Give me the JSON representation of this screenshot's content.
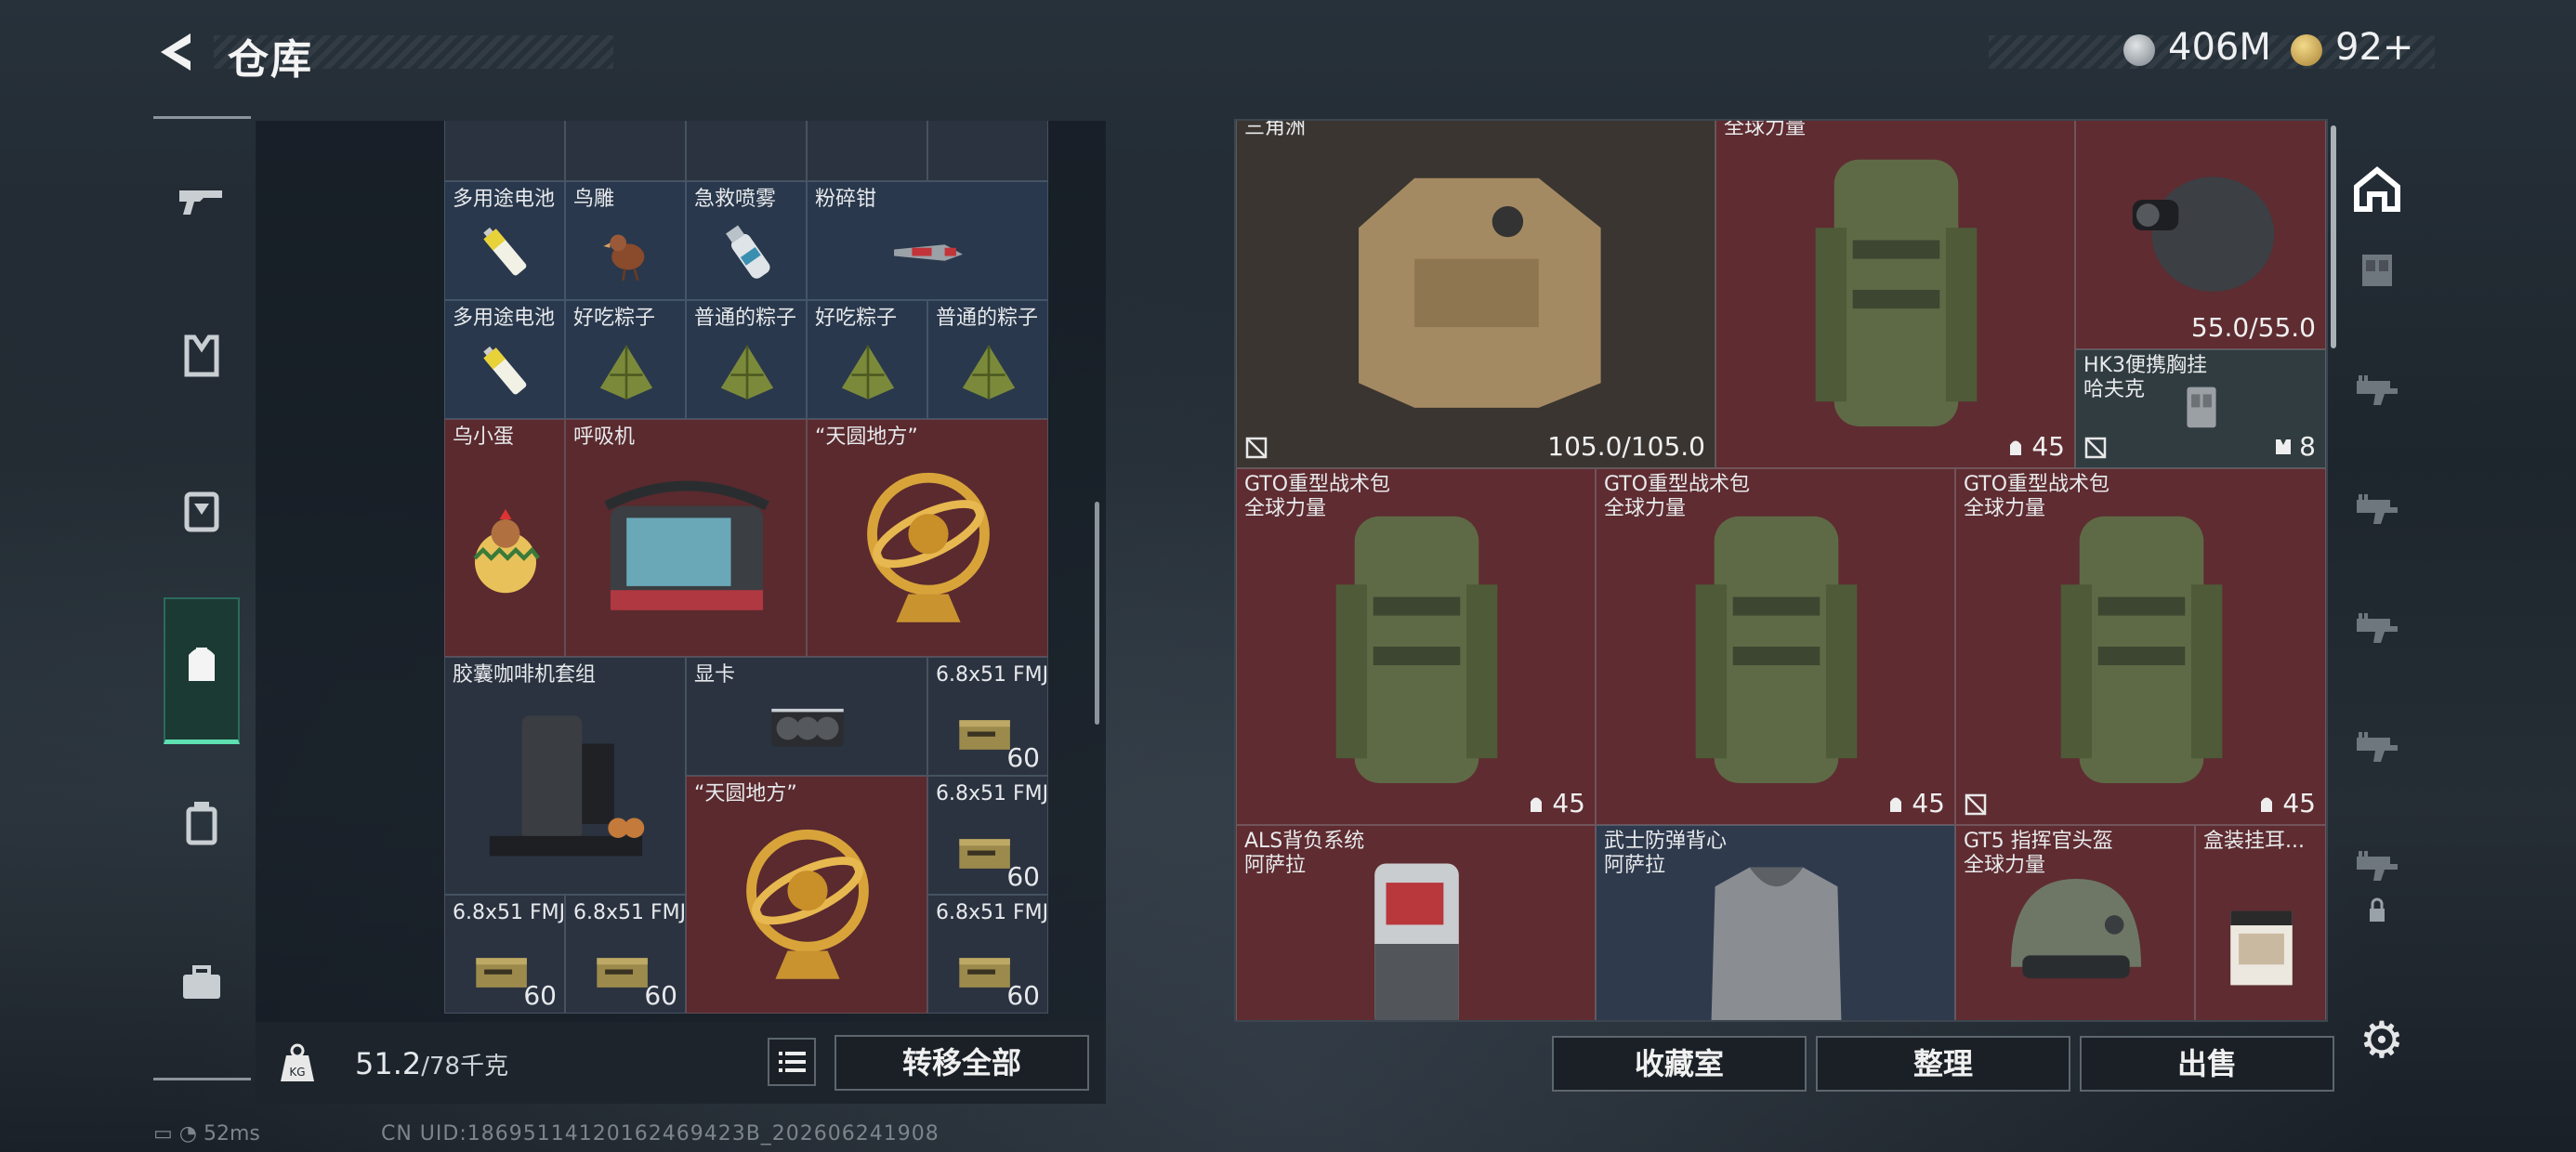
{
  "header": {
    "title": "仓库",
    "silver": "406M",
    "gold": "92+"
  },
  "sidebar": {
    "items": [
      "gun-icon",
      "armor-vest-icon",
      "chest-rig-icon",
      "backpack-icon",
      "case-icon",
      "toolbox-icon"
    ],
    "active": 3
  },
  "left_grid": [
    {
      "name": "多用途电池",
      "count": "",
      "col": 0,
      "row": 0,
      "w": 1,
      "h": 1,
      "color": "blue",
      "icon": "battery"
    },
    {
      "name": "鸟雕",
      "count": "",
      "col": 1,
      "row": 0,
      "w": 1,
      "h": 1,
      "color": "blue",
      "icon": "bird"
    },
    {
      "name": "急救喷雾",
      "count": "",
      "col": 2,
      "row": 0,
      "w": 1,
      "h": 1,
      "color": "blue",
      "icon": "spray"
    },
    {
      "name": "粉碎钳",
      "count": "",
      "col": 3,
      "row": 0,
      "w": 2,
      "h": 1,
      "color": "blue",
      "icon": "cutter"
    },
    {
      "name": "多用途电池",
      "count": "",
      "col": 0,
      "row": 1,
      "w": 1,
      "h": 1,
      "color": "blue",
      "icon": "battery"
    },
    {
      "name": "好吃粽子",
      "count": "",
      "col": 1,
      "row": 1,
      "w": 1,
      "h": 1,
      "color": "blue",
      "icon": "zongzi"
    },
    {
      "name": "普通的粽子",
      "count": "",
      "col": 2,
      "row": 1,
      "w": 1,
      "h": 1,
      "color": "blue",
      "icon": "zongzi"
    },
    {
      "name": "好吃粽子",
      "count": "",
      "col": 3,
      "row": 1,
      "w": 1,
      "h": 1,
      "color": "blue",
      "icon": "zongzi"
    },
    {
      "name": "普通的粽子",
      "count": "",
      "col": 4,
      "row": 1,
      "w": 1,
      "h": 1,
      "color": "blue",
      "icon": "zongzi"
    },
    {
      "name": "乌小蛋",
      "count": "",
      "col": 0,
      "row": 2,
      "w": 1,
      "h": 2,
      "color": "red",
      "icon": "egg"
    },
    {
      "name": "呼吸机",
      "count": "",
      "col": 1,
      "row": 2,
      "w": 2,
      "h": 2,
      "color": "red",
      "icon": "machine"
    },
    {
      "name": "“天圆地方”",
      "count": "",
      "col": 3,
      "row": 2,
      "w": 2,
      "h": 2,
      "color": "red",
      "icon": "globe"
    },
    {
      "name": "胶囊咖啡机套组",
      "count": "",
      "col": 0,
      "row": 4,
      "w": 2,
      "h": 2,
      "color": "dark",
      "icon": "coffee"
    },
    {
      "name": "显卡",
      "count": "",
      "col": 2,
      "row": 4,
      "w": 2,
      "h": 1,
      "color": "dark",
      "icon": "gpu"
    },
    {
      "name": "6.8x51 FMJ",
      "count": "60",
      "col": 4,
      "row": 4,
      "w": 1,
      "h": 1,
      "color": "dark",
      "icon": "ammo"
    },
    {
      "name": "“天圆地方”",
      "count": "",
      "col": 2,
      "row": 5,
      "w": 2,
      "h": 2,
      "color": "red",
      "icon": "globe"
    },
    {
      "name": "6.8x51 FMJ",
      "count": "60",
      "col": 4,
      "row": 5,
      "w": 1,
      "h": 1,
      "color": "dark",
      "icon": "ammo"
    },
    {
      "name": "6.8x51 FMJ",
      "count": "60",
      "col": 0,
      "row": 6,
      "w": 1,
      "h": 1,
      "color": "dark",
      "icon": "ammo"
    },
    {
      "name": "6.8x51 FMJ",
      "count": "60",
      "col": 1,
      "row": 6,
      "w": 1,
      "h": 1,
      "color": "dark",
      "icon": "ammo"
    },
    {
      "name": "6.8x51 FMJ",
      "count": "60",
      "col": 4,
      "row": 6,
      "w": 1,
      "h": 1,
      "color": "dark",
      "icon": "ammo"
    }
  ],
  "left_bar": {
    "weight_current": "51.2",
    "weight_max": "/78千克",
    "transfer_label": "转移全部"
  },
  "right_grid": [
    {
      "name": "三角洲",
      "sub": "",
      "value": "105.0/105.0",
      "badge": "",
      "col": 0,
      "row": 0,
      "w": 4,
      "h": 3,
      "color": "dark",
      "icon": "vest",
      "noins": true
    },
    {
      "name": "全球力量",
      "sub": "",
      "value": "45",
      "badge": "helmet",
      "col": 4,
      "row": 0,
      "w": 3,
      "h": 3,
      "color": "red",
      "icon": "pack",
      "noins": false
    },
    {
      "name": "",
      "sub": "",
      "value": "55.0/55.0",
      "badge": "",
      "col": 7,
      "row": 0,
      "w": 2,
      "h": 2,
      "color": "red",
      "icon": "nvg",
      "noins": false
    },
    {
      "name": "HK3便携胸挂",
      "sub": "哈夫克",
      "value": "8",
      "badge": "rig",
      "col": 7,
      "row": 2,
      "w": 2,
      "h": 1,
      "color": "teal",
      "icon": "rig",
      "noins": true
    },
    {
      "name": "GTO重型战术包",
      "sub": "全球力量",
      "value": "45",
      "badge": "helmet",
      "col": 0,
      "row": 3,
      "w": 3,
      "h": 3,
      "color": "red",
      "icon": "pack",
      "noins": false
    },
    {
      "name": "GTO重型战术包",
      "sub": "全球力量",
      "value": "45",
      "badge": "helmet",
      "col": 3,
      "row": 3,
      "w": 3,
      "h": 3,
      "color": "red",
      "icon": "pack",
      "noins": false
    },
    {
      "name": "GTO重型战术包",
      "sub": "全球力量",
      "value": "45",
      "badge": "helmet",
      "col": 6,
      "row": 3,
      "w": 3,
      "h": 3,
      "color": "red",
      "icon": "pack",
      "noins": true
    },
    {
      "name": "ALS背负系统",
      "sub": "阿萨拉",
      "value": "",
      "badge": "",
      "col": 0,
      "row": 6,
      "w": 3,
      "h": 2,
      "color": "red",
      "icon": "pack2",
      "noins": false
    },
    {
      "name": "武士防弹背心",
      "sub": "阿萨拉",
      "value": "",
      "badge": "",
      "col": 3,
      "row": 6,
      "w": 3,
      "h": 2,
      "color": "navy",
      "icon": "vest2",
      "noins": false
    },
    {
      "name": "GT5 指挥官头盔",
      "sub": "全球力量",
      "value": "",
      "badge": "",
      "col": 6,
      "row": 6,
      "w": 2,
      "h": 2,
      "color": "red",
      "icon": "helmet",
      "noins": false
    },
    {
      "name": "盒装挂耳...",
      "sub": "",
      "value": "",
      "badge": "",
      "col": 8,
      "row": 6,
      "w": 1,
      "h": 2,
      "color": "red",
      "icon": "box",
      "noins": false
    }
  ],
  "right_sidebar": [
    "home-icon",
    "rig-slot-icon",
    "gun-slot-icon",
    "gun-slot-icon",
    "gun-slot-icon",
    "gun-slot-icon",
    "gun-slot-icon",
    "lock-icon"
  ],
  "right_buttons": {
    "collection": "收藏室",
    "sort": "整理",
    "sell": "出售"
  },
  "status_bar": {
    "ping": "52ms",
    "uid": "CN UID:18695114120162469423B_202606241908"
  }
}
